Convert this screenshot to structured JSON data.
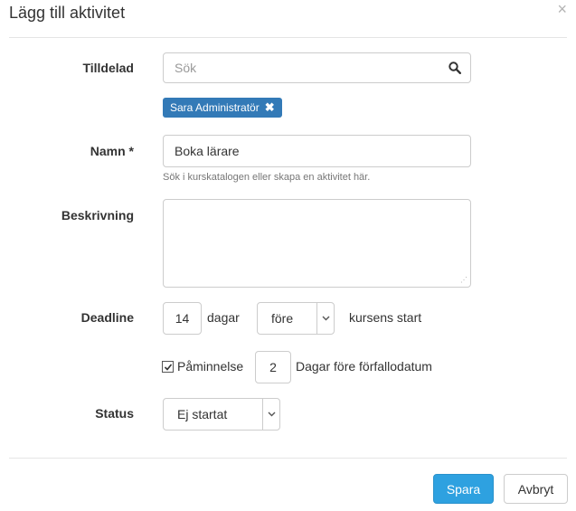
{
  "modal": {
    "title": "Lägg till aktivitet",
    "close_label": "×"
  },
  "form": {
    "assigned": {
      "label": "Tilldelad",
      "placeholder": "Sök",
      "selected_tag": "Sara Administratör",
      "tag_remove": "✖"
    },
    "name": {
      "label": "Namn *",
      "value": "Boka lärare",
      "help": "Sök i kurskatalogen eller skapa en aktivitet här."
    },
    "description": {
      "label": "Beskrivning",
      "value": ""
    },
    "deadline": {
      "label": "Deadline",
      "days_value": "14",
      "days_unit": "dagar",
      "relation_selected": "före",
      "suffix": "kursens start"
    },
    "reminder": {
      "checked": true,
      "label": "Påminnelse",
      "days_value": "2",
      "suffix": "Dagar före förfallodatum"
    },
    "status": {
      "label": "Status",
      "selected": "Ej startat"
    }
  },
  "footer": {
    "save_label": "Spara",
    "cancel_label": "Avbryt"
  },
  "colors": {
    "primary": "#2ea1e0",
    "tag": "#337ab7"
  },
  "icons": [
    "close-icon",
    "search-icon",
    "remove-tag-icon",
    "chevron-down-icon",
    "checkbox-checked-icon",
    "resize-grip-icon"
  ]
}
